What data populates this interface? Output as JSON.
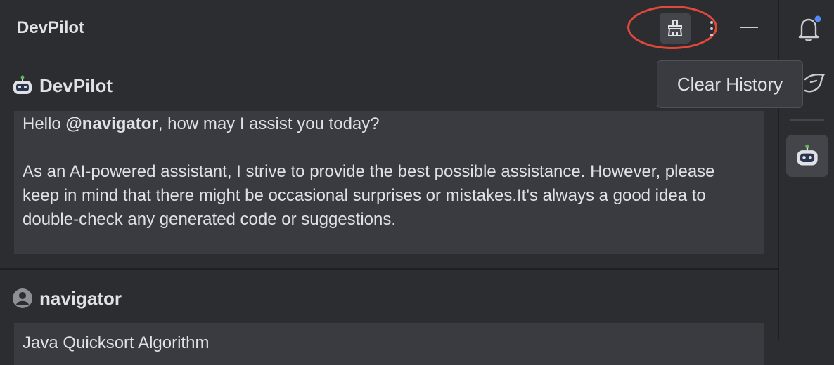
{
  "app": {
    "title": "DevPilot"
  },
  "toolbar": {
    "clear_icon": "broom-icon",
    "more_icon": "kebab-menu-icon",
    "minimize_icon": "minimize-icon",
    "tooltip": "Clear History",
    "highlight_color": "#e0493a"
  },
  "messages": [
    {
      "author": "DevPilot",
      "avatar": "robot-icon",
      "paragraphs": [
        {
          "prefix": "Hello ",
          "mention": "@navigator",
          "suffix": ", how may I assist you today?"
        },
        {
          "text": "As an AI-powered assistant, I strive to provide the best possible assistance. However, please keep in mind that there might be occasional surprises or mistakes.It's always a good idea to double-check any generated code or suggestions."
        }
      ]
    },
    {
      "author": "navigator",
      "avatar": "user-icon",
      "text": "Java Quicksort Algorithm"
    }
  ],
  "rightbar": {
    "notifications_icon": "bell-icon",
    "notification_dot_color": "#548af7",
    "ai_icon": "assistant-icon",
    "active_icon": "robot-icon"
  }
}
